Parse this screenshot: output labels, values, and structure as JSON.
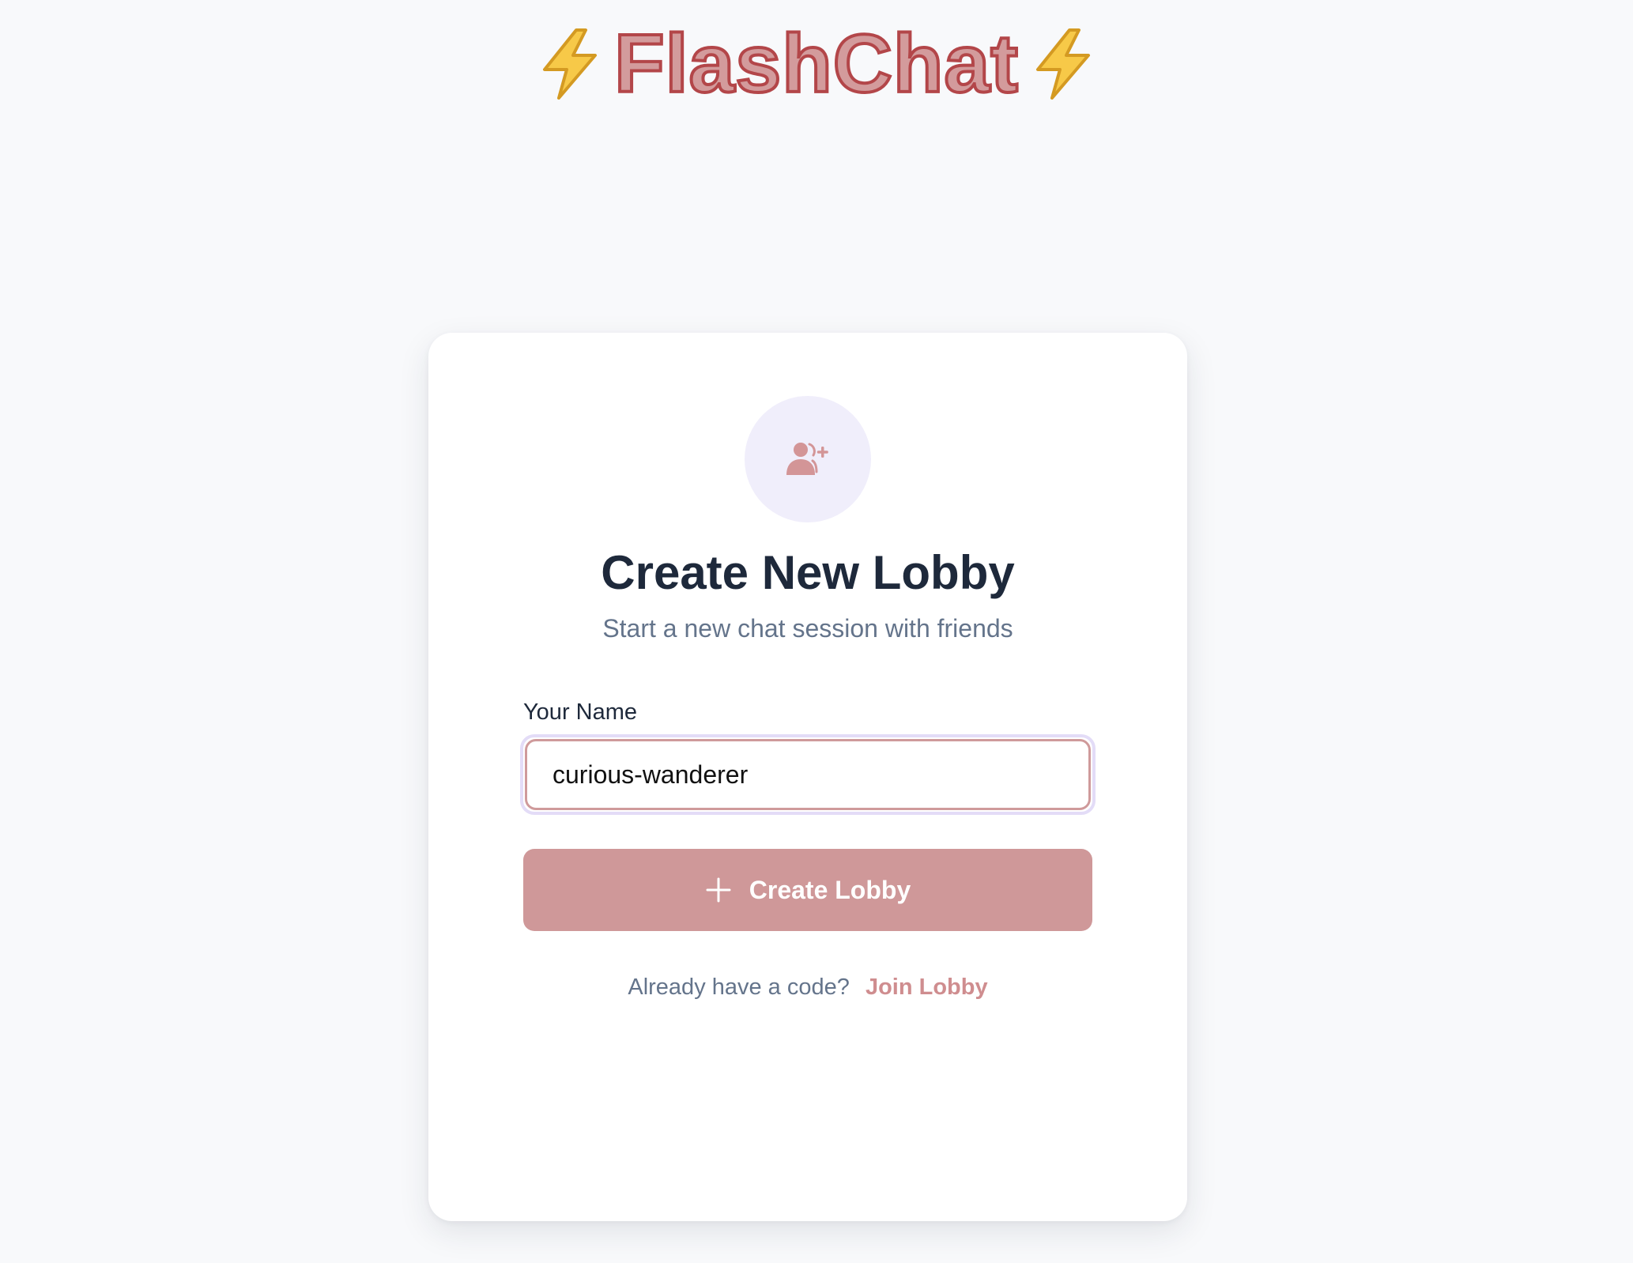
{
  "header": {
    "brand_name": "FlashChat",
    "left_icon": "lightning-bolt-icon",
    "right_icon": "lightning-bolt-icon"
  },
  "card": {
    "icon": "user-plus-icon",
    "title": "Create New Lobby",
    "subtitle": "Start a new chat session with friends",
    "name_field": {
      "label": "Your Name",
      "value": "curious-wanderer"
    },
    "create_button": {
      "icon": "plus-icon",
      "label": "Create Lobby"
    },
    "join_prompt": {
      "text": "Already have a code?",
      "link_label": "Join Lobby"
    }
  },
  "colors": {
    "background": "#f8f9fb",
    "brand_fill": "#d39b9c",
    "brand_stroke": "#b34649",
    "accent": "#cf9899",
    "avatar_bg": "#f0eefb",
    "title_text": "#1e293b",
    "muted_text": "#64748b",
    "bolt_yellow": "#f7c948"
  }
}
